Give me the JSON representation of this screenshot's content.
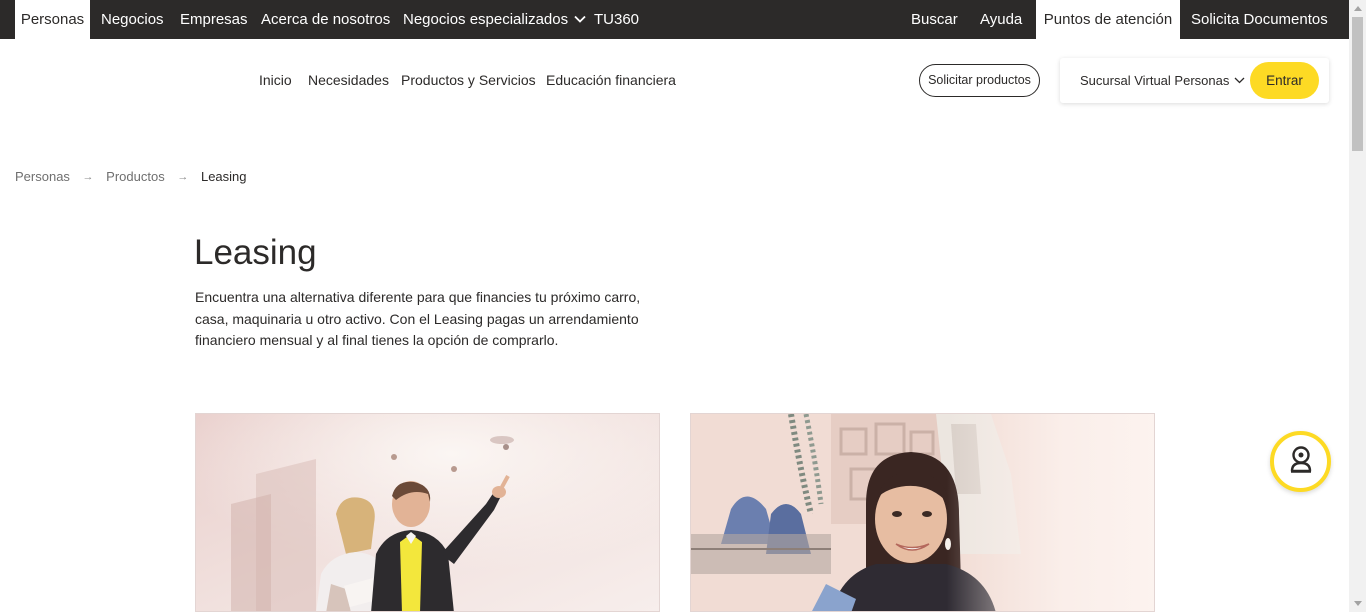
{
  "topbar": {
    "tabs": [
      "Personas",
      "Negocios",
      "Empresas",
      "Acerca de nosotros",
      "Negocios especializados",
      "TU360"
    ],
    "right_tabs": [
      "Buscar",
      "Ayuda",
      "Puntos de atención",
      "Solicita Documentos"
    ],
    "active_tab": "Personas",
    "active_right_tab": "Puntos de atención"
  },
  "mainnav": {
    "items": [
      "Inicio",
      "Necesidades",
      "Productos y Servicios",
      "Educación financiera"
    ],
    "solicitar_label": "Solicitar productos",
    "sucursal_label": "Sucursal Virtual Personas",
    "entrar_label": "Entrar"
  },
  "breadcrumb": {
    "items": [
      "Personas",
      "Productos",
      "Leasing"
    ],
    "separator": "→"
  },
  "hero": {
    "title": "Leasing",
    "description": "Encuentra una alternativa diferente para que financies tu próximo carro, casa, maquinaria u otro activo. Con el Leasing pagas un arrendamiento financiero mensual y al final tienes la opción de comprarlo."
  },
  "cards": [
    {
      "image": "couple-in-house-photo"
    },
    {
      "image": "smiling-shop-owner-photo"
    }
  ],
  "icons": {
    "chat": "chat-agent-icon",
    "dropdown": "chevron-down-icon",
    "breadcrumb_arrow": "arrow-right-icon"
  },
  "colors": {
    "brand_yellow": "#fdda24",
    "topbar_bg": "#2c2a29",
    "text": "#2c2a29"
  }
}
